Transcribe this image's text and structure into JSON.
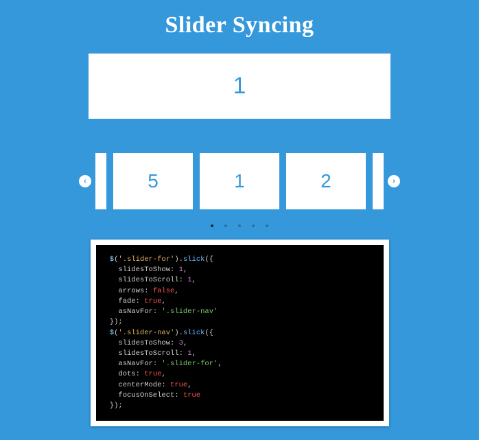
{
  "title": "Slider Syncing",
  "main_slide": "1",
  "nav_items": [
    "",
    "5",
    "1",
    "2",
    ""
  ],
  "arrows": {
    "prev": "‹",
    "next": "›"
  },
  "dots": {
    "count": 5,
    "active_index": 0
  },
  "code_tokens": [
    [
      {
        "t": " $",
        "c": "dollar"
      },
      {
        "t": "(",
        "c": "punc"
      },
      {
        "t": "'.slider-for'",
        "c": "sel"
      },
      {
        "t": ").",
        "c": "punc"
      },
      {
        "t": "slick",
        "c": "fn"
      },
      {
        "t": "({",
        "c": "punc"
      }
    ],
    [
      {
        "t": "   slidesToShow",
        "c": "key"
      },
      {
        "t": ": ",
        "c": "punc"
      },
      {
        "t": "1",
        "c": "num"
      },
      {
        "t": ",",
        "c": "punc"
      }
    ],
    [
      {
        "t": "   slidesToScroll",
        "c": "key"
      },
      {
        "t": ": ",
        "c": "punc"
      },
      {
        "t": "1",
        "c": "num"
      },
      {
        "t": ",",
        "c": "punc"
      }
    ],
    [
      {
        "t": "   arrows",
        "c": "key"
      },
      {
        "t": ": ",
        "c": "punc"
      },
      {
        "t": "false",
        "c": "bool"
      },
      {
        "t": ",",
        "c": "punc"
      }
    ],
    [
      {
        "t": "   fade",
        "c": "key"
      },
      {
        "t": ": ",
        "c": "punc"
      },
      {
        "t": "true",
        "c": "bool"
      },
      {
        "t": ",",
        "c": "punc"
      }
    ],
    [
      {
        "t": "   asNavFor",
        "c": "key"
      },
      {
        "t": ": ",
        "c": "punc"
      },
      {
        "t": "'.slider-nav'",
        "c": "str"
      }
    ],
    [
      {
        "t": " });",
        "c": "punc"
      }
    ],
    [
      {
        "t": " $",
        "c": "dollar"
      },
      {
        "t": "(",
        "c": "punc"
      },
      {
        "t": "'.slider-nav'",
        "c": "sel"
      },
      {
        "t": ").",
        "c": "punc"
      },
      {
        "t": "slick",
        "c": "fn"
      },
      {
        "t": "({",
        "c": "punc"
      }
    ],
    [
      {
        "t": "   slidesToShow",
        "c": "key"
      },
      {
        "t": ": ",
        "c": "punc"
      },
      {
        "t": "3",
        "c": "num"
      },
      {
        "t": ",",
        "c": "punc"
      }
    ],
    [
      {
        "t": "   slidesToScroll",
        "c": "key"
      },
      {
        "t": ": ",
        "c": "punc"
      },
      {
        "t": "1",
        "c": "num"
      },
      {
        "t": ",",
        "c": "punc"
      }
    ],
    [
      {
        "t": "   asNavFor",
        "c": "key"
      },
      {
        "t": ": ",
        "c": "punc"
      },
      {
        "t": "'.slider-for'",
        "c": "str"
      },
      {
        "t": ",",
        "c": "punc"
      }
    ],
    [
      {
        "t": "   dots",
        "c": "key"
      },
      {
        "t": ": ",
        "c": "punc"
      },
      {
        "t": "true",
        "c": "bool"
      },
      {
        "t": ",",
        "c": "punc"
      }
    ],
    [
      {
        "t": "   centerMode",
        "c": "key"
      },
      {
        "t": ": ",
        "c": "punc"
      },
      {
        "t": "true",
        "c": "bool"
      },
      {
        "t": ",",
        "c": "punc"
      }
    ],
    [
      {
        "t": "   focusOnSelect",
        "c": "key"
      },
      {
        "t": ": ",
        "c": "punc"
      },
      {
        "t": "true",
        "c": "bool"
      }
    ],
    [
      {
        "t": " });",
        "c": "punc"
      }
    ]
  ]
}
